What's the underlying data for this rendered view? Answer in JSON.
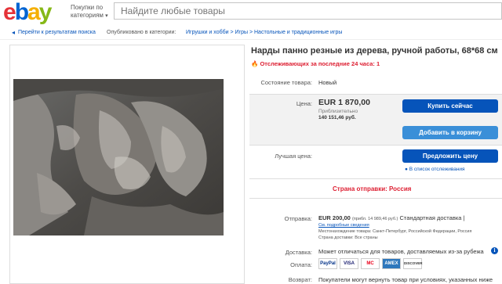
{
  "header": {
    "logo": [
      "e",
      "b",
      "a",
      "y"
    ],
    "shop_by": "Покупки по категориям",
    "search_placeholder": "Найдите любые товары"
  },
  "breadcrumb": {
    "back": "Перейти к результатам поиска",
    "published": "Опубликовано в категории:",
    "trail": "Игрушки и хобби > Игры > Настольные и традиционные игры"
  },
  "listing": {
    "title": "Нарды панно резные из дерева, ручной работы, 68*68 см",
    "watchers": "Отслеживающих за последние 24 часа: 1",
    "condition_label": "Состояние товара:",
    "condition_value": "Новый",
    "price_label": "Цена:",
    "price": "EUR 1 870,00",
    "approx_label": "Приблизительно",
    "approx_value": "140 151,46 руб.",
    "best_offer_label": "Лучшая цена:",
    "buy_now": "Купить сейчас",
    "add_to_cart": "Добавить в корзину",
    "make_offer": "Предложить цену",
    "watchlist": "В список отслеживания",
    "ships_from": "Страна отправки: Россия",
    "shipping_label": "Отправка:",
    "shipping_price": "EUR 200,00",
    "shipping_approx": "(прибл. 14 989,46 руб.)",
    "shipping_method": "Стандартная доставка |",
    "shipping_details": "См. подробные сведения",
    "item_location": "Местонахождение товара: Санкт-Петербург, Российской Федерации, Россия",
    "ships_to": "Страна доставки: Все страны",
    "delivery_label": "Доставка:",
    "delivery_value": "Может отличаться для товаров, доставляемых из-за рубежа",
    "payment_label": "Оплата:",
    "payment_methods": [
      "PayPal",
      "VISA",
      "MC",
      "AMEX",
      "DISCOVER"
    ],
    "returns_label": "Возврат:",
    "returns_value": "Покупатели могут вернуть товар при условиях, указанных ниже"
  },
  "colors": {
    "link": "#0654ba",
    "alert": "#dd1e31",
    "button_primary": "#0654ba",
    "button_secondary": "#3a8fd8"
  }
}
